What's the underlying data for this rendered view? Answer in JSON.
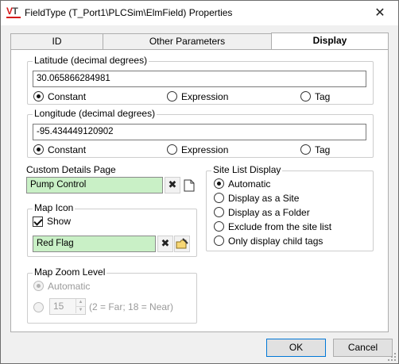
{
  "window": {
    "title": "FieldType (T_Port1\\PLCSim\\ElmField) Properties",
    "icon_name": "vtscada-logo-icon",
    "icon_letters": [
      "V",
      "T"
    ],
    "close_glyph": "✕"
  },
  "tabs": [
    {
      "label": "ID",
      "active": false
    },
    {
      "label": "Other Parameters",
      "active": false
    },
    {
      "label": "Display",
      "active": true
    }
  ],
  "latitude": {
    "title": "Latitude (decimal degrees)",
    "value": "30.065866284981",
    "options": [
      "Constant",
      "Expression",
      "Tag"
    ],
    "selected": "Constant"
  },
  "longitude": {
    "title": "Longitude (decimal degrees)",
    "value": "-95.434449120902",
    "options": [
      "Constant",
      "Expression",
      "Tag"
    ],
    "selected": "Constant"
  },
  "custom_details": {
    "label": "Custom Details Page",
    "value": "Pump Control",
    "clear_glyph": "✖",
    "browse_icon": "page-icon"
  },
  "map_icon": {
    "title": "Map Icon",
    "show_label": "Show",
    "show_checked": true,
    "value": "Red Flag",
    "clear_glyph": "✖",
    "edit_icon": "folder-edit-icon"
  },
  "map_zoom": {
    "title": "Map Zoom Level",
    "automatic_label": "Automatic",
    "spin_value": "15",
    "hint": "(2 = Far;  18 = Near)",
    "up_glyph": "▲",
    "down_glyph": "▼"
  },
  "site_list": {
    "title": "Site List Display",
    "options": [
      "Automatic",
      "Display as a Site",
      "Display as a Folder",
      "Exclude from the site list",
      "Only display child tags"
    ],
    "selected": "Automatic"
  },
  "buttons": {
    "ok": "OK",
    "cancel": "Cancel"
  },
  "colors": {
    "green_field": "#c9f0c6",
    "default_button_border": "#0078d7"
  }
}
